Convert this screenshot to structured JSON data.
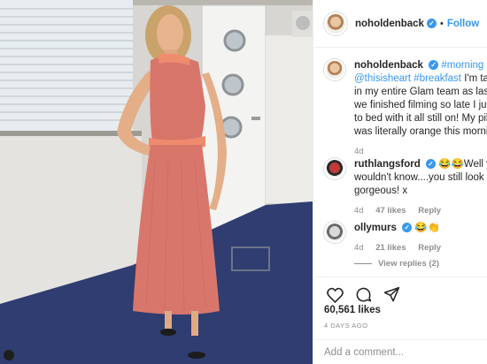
{
  "post": {
    "author": "noholdenback",
    "follow_label": "Follow",
    "dot": "•"
  },
  "caption": {
    "user": "noholdenback",
    "tag1": "#morning",
    "line1_rest": "",
    "line2_user_tag": "@thisisheart",
    "line2_tag": "#breakfast",
    "line2_rest": " I'm tagging",
    "line3": "in my entire Glam team as last nigh",
    "line4": "we finished filming so late I just we",
    "line5": "to bed with it all still on! My pillow",
    "line6": "was literally orange this morning",
    "age": "4d"
  },
  "comments": [
    {
      "user": "ruthlangsford",
      "emoji": "😂😂",
      "line1_rest": "Well you",
      "line2": "wouldn't know....you still look",
      "line3": "gorgeous! x",
      "age": "4d",
      "likes": "47 likes",
      "reply": "Reply"
    },
    {
      "user": "ollymurs",
      "emoji": "😂👏",
      "age": "4d",
      "likes": "21 likes",
      "reply": "Reply"
    }
  ],
  "view_replies": "View replies (2)",
  "likes_count": "60,561 likes",
  "posted_ago": "4 DAYS AGO",
  "add_comment_placeholder": "Add a comment...",
  "icons": [
    "heart-icon",
    "comment-icon",
    "share-icon",
    "verified-icon"
  ],
  "colors": {
    "accent": "#3897f0",
    "muted": "#8e8e8e",
    "dress": "#d9766b",
    "sash": "#f08a6c",
    "carpet": "#2d3a6b"
  }
}
